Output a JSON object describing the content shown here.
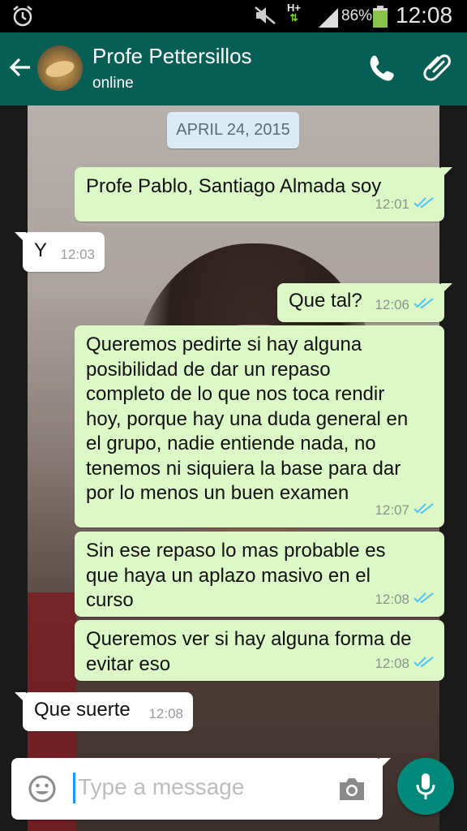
{
  "status_bar": {
    "network": "H+",
    "battery": "86%",
    "time": "12:08",
    "icons": [
      "alarm-icon",
      "mute-icon",
      "signal-icon",
      "battery-icon"
    ]
  },
  "header": {
    "contact_name": "Profe Pettersillos",
    "status": "online",
    "icons": [
      "back-arrow-icon",
      "phone-icon",
      "attach-icon"
    ],
    "color": "#075e54"
  },
  "date_chip": "APRIL 24, 2015",
  "messages": [
    {
      "dir": "out",
      "text": "Profe Pablo, Santiago Almada soy",
      "time": "12:01"
    },
    {
      "dir": "in",
      "text": "Y",
      "time": "12:03"
    },
    {
      "dir": "out",
      "text": "Que tal?",
      "time": "12:06"
    },
    {
      "dir": "out",
      "text": "Queremos pedirte si hay alguna\nposibilidad de dar un repaso\ncompleto de lo que nos toca rendir\nhoy, porque hay una duda general en\nel grupo, nadie entiende nada, no\ntenemos ni siquiera la base para dar\npor lo menos un buen examen",
      "time": "12:07"
    },
    {
      "dir": "out",
      "text": "Sin ese repaso lo mas probable es\nque haya un aplazo masivo en el\ncurso",
      "time": "12:08"
    },
    {
      "dir": "out",
      "text": "Queremos ver si hay alguna forma de\nevitar eso",
      "time": "12:08"
    },
    {
      "dir": "in",
      "text": "Que suerte",
      "time": "12:08"
    }
  ],
  "input": {
    "placeholder": "Type a message",
    "icons": [
      "emoji-icon",
      "camera-icon",
      "mic-icon"
    ]
  },
  "colors": {
    "outgoing_bubble": "#dcf8c6",
    "incoming_bubble": "#ffffff",
    "read_ticks": "#4fc3f7",
    "mic_button": "#00897b"
  }
}
